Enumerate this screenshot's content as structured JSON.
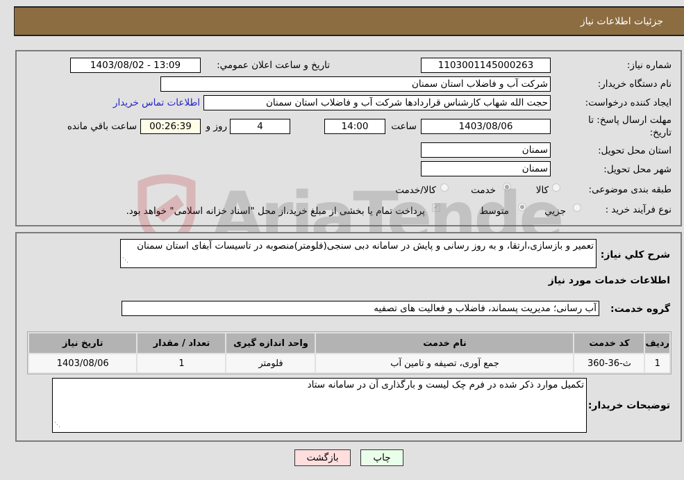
{
  "header": {
    "title": "جزئیات اطلاعات نیاز"
  },
  "form": {
    "need_number_label": "شماره نیاز:",
    "need_number": "1103001145000263",
    "announce_label": "تاریخ و ساعت اعلان عمومي:",
    "announce_value": "1403/08/02 - 13:09",
    "buyer_org_label": "نام دستگاه خریدار:",
    "buyer_org": "شرکت آب و فاضلاب استان سمنان",
    "creator_label": "ایجاد کننده درخواست:",
    "creator": "حجت الله شهاب کارشناس قراردادها شرکت آب و فاضلاب استان سمنان",
    "contact_link": "اطلاعات تماس خریدار",
    "deadline_label_1": "مهلت ارسال پاسخ: تا",
    "deadline_label_2": "تاریخ:",
    "deadline_date": "1403/08/06",
    "time_label": "ساعت",
    "deadline_time": "14:00",
    "days_value": "4",
    "days_label": "روز و",
    "remaining_value": "00:26:39",
    "remaining_label": "ساعت باقي مانده",
    "province_label": "استان محل تحویل:",
    "province": "سمنان",
    "city_label": "شهر محل تحویل:",
    "city": "سمنان",
    "category_label": "طبقه بندی موضوعی:",
    "category_options": [
      {
        "label": "کالا",
        "selected": false
      },
      {
        "label": "خدمت",
        "selected": true
      },
      {
        "label": "کالا/خدمت",
        "selected": false
      }
    ],
    "process_label": "نوع فرآیند خرید :",
    "process_options": [
      {
        "label": "جزيي",
        "selected": false
      },
      {
        "label": "متوسط",
        "selected": true
      }
    ],
    "payment_note": "پرداخت تمام یا بخشی از مبلغ خرید،از محل \"اسناد خزانه اسلامی\" خواهد بود.",
    "payment_checked": true
  },
  "details": {
    "description_label": "شرح کلي نیاز:",
    "description": "تعمیر و بازسازی،ارتقا، و به روز رسانی و پایش در سامانه دبی سنجی(فلومتر)منصوبه در تاسیسات آبفای استان سمنان",
    "services_heading": "اطلاعات خدمات مورد نیاز",
    "service_group_label": "گروه خدمت:",
    "service_group": "آب رسانی؛ مدیریت پسماند، فاضلاب و فعالیت های تصفیه",
    "table": {
      "headers": [
        "ردیف",
        "کد خدمت",
        "نام خدمت",
        "واحد اندازه گیری",
        "تعداد / مقدار",
        "تاریخ نیاز"
      ],
      "rows": [
        [
          "1",
          "ث-36-360",
          "جمع آوری، تصیفه و تامین آب",
          "فلومتر",
          "1",
          "1403/08/06"
        ]
      ]
    },
    "buyer_notes_label": "توضیحات خریدار:",
    "buyer_notes": "تکمیل موارد ذکر شده در فرم  چک لیست و بارگذاری آن در سامانه ستاد"
  },
  "buttons": {
    "print": "چاپ",
    "back": "بازگشت"
  },
  "watermark": {
    "text": "AriaTender.net",
    "color_text": "#5a5a5a",
    "color_logo": "#c0282d"
  },
  "colors": {
    "title_bar": "#8c6d42",
    "print_bg": "#eaffea",
    "back_bg": "#ffdede"
  }
}
